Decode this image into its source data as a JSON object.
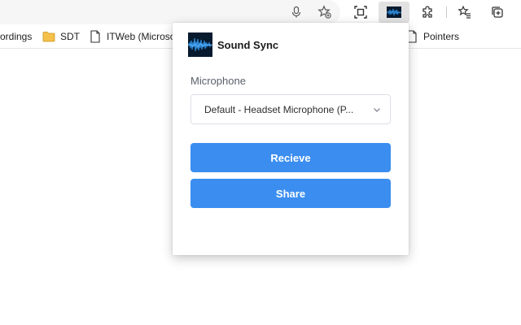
{
  "toolbar": {
    "icons": [
      "microphone-icon",
      "favorite-add-icon",
      "screenshot-icon",
      "sound-sync-extension-icon",
      "extensions-puzzle-icon",
      "favorites-icon",
      "collections-icon"
    ]
  },
  "bookmarks": {
    "items": [
      {
        "label": "ordings",
        "icon": "none"
      },
      {
        "label": "SDT",
        "icon": "folder-icon"
      },
      {
        "label": "ITWeb (Microsof",
        "icon": "page-icon"
      },
      {
        "label": "Pointers",
        "icon": "page-icon"
      }
    ]
  },
  "popup": {
    "title": "Sound Sync",
    "mic_label": "Microphone",
    "mic_selected": "Default - Headset Microphone (P...",
    "receive_label": "Recieve",
    "share_label": "Share"
  },
  "colors": {
    "primary_button": "#3b8ef0",
    "folder": "#f5c04a",
    "logo_bg": "#071a2e",
    "logo_wave": "#2f8fe0"
  }
}
